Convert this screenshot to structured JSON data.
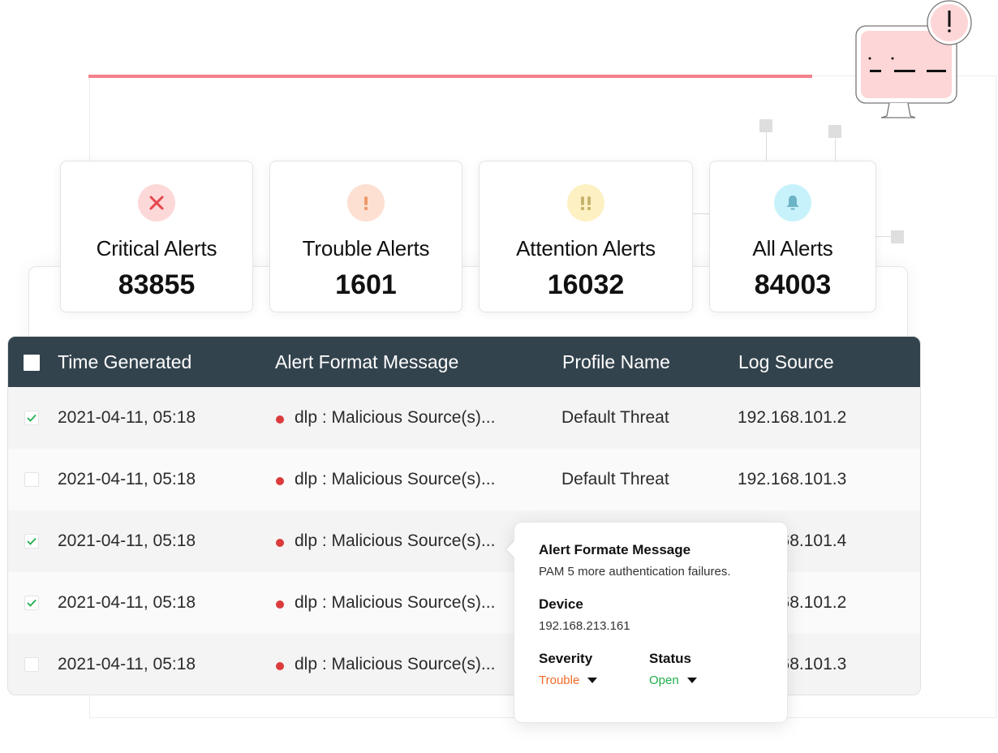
{
  "summary_cards": [
    {
      "label": "Critical Alerts",
      "count": "83855",
      "icon": "close-icon",
      "icon_color": "#e5484d",
      "icon_bg": "#fdd8d8"
    },
    {
      "label": "Trouble Alerts",
      "count": "1601",
      "icon": "exclamation-icon",
      "icon_color": "#ee9a6a",
      "icon_bg": "#fde0d2"
    },
    {
      "label": "Attention Alerts",
      "count": "16032",
      "icon": "double-exclamation-icon",
      "icon_color": "#c6b46a",
      "icon_bg": "#fdf1c4"
    },
    {
      "label": "All Alerts",
      "count": "84003",
      "icon": "bell-icon",
      "icon_color": "#6db3c7",
      "icon_bg": "#c8f2fb"
    }
  ],
  "table": {
    "columns": [
      "Time Generated",
      "Alert Format Message",
      "Profile Name",
      "Log Source"
    ],
    "rows": [
      {
        "checked": true,
        "time": "2021-04-11, 05:18",
        "message": "dlp : Malicious Source(s)...",
        "profile": "Default Threat",
        "source": "192.168.101.2"
      },
      {
        "checked": false,
        "time": "2021-04-11, 05:18",
        "message": "dlp : Malicious Source(s)...",
        "profile": "Default Threat",
        "source": "192.168.101.3"
      },
      {
        "checked": true,
        "time": "2021-04-11, 05:18",
        "message": "dlp : Malicious Source(s)...",
        "profile": "",
        "source": "192.168.101.4"
      },
      {
        "checked": true,
        "time": "2021-04-11, 05:18",
        "message": "dlp : Malicious Source(s)...",
        "profile": "",
        "source": "192.168.101.2"
      },
      {
        "checked": false,
        "time": "2021-04-11, 05:18",
        "message": "dlp : Malicious Source(s)...",
        "profile": "",
        "source": "192.168.101.3"
      }
    ]
  },
  "popover": {
    "message_label": "Alert Formate Message",
    "message_value": "PAM 5 more authentication failures.",
    "device_label": "Device",
    "device_value": "192.168.213.161",
    "severity_label": "Severity",
    "severity_value": "Trouble",
    "severity_color": "#f26b2a",
    "status_label": "Status",
    "status_value": "Open",
    "status_color": "#1fae4b"
  },
  "colors": {
    "accent": "#f4808a",
    "table_header": "#33434d",
    "check": "#1fae4b",
    "severity_dot": "#dc3b3b"
  }
}
